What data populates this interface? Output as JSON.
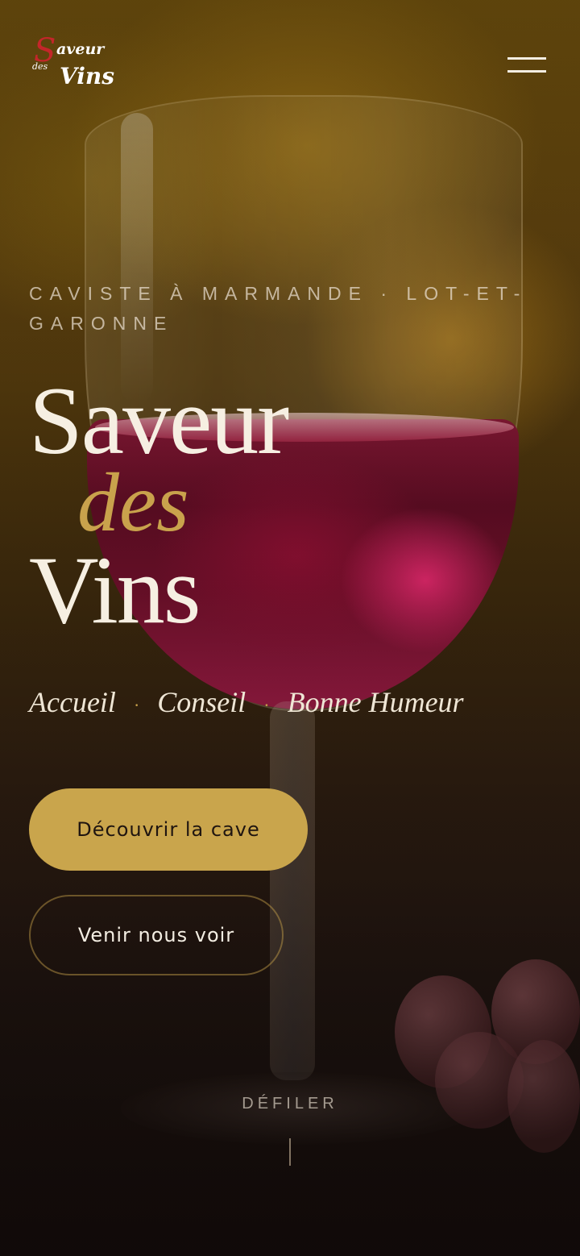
{
  "header": {
    "logo": {
      "initial": "S",
      "word1": "aveur",
      "word2": "des",
      "word3": "Vins"
    },
    "menu_icon": "hamburger-menu-icon"
  },
  "hero": {
    "eyebrow": "CAVISTE À MARMANDE · LOT-ET-GARONNE",
    "title": {
      "line1": "Saveur",
      "line2": "des",
      "line3": "Vins"
    },
    "tagline": {
      "item1": "Accueil",
      "item2": "Conseil",
      "item3": "Bonne Humeur",
      "separator": "·"
    },
    "primary_button": "Découvrir la cave",
    "secondary_button": "Venir nous voir",
    "scroll_label": "DÉFILER"
  },
  "colors": {
    "accent_gold": "#c9a54c",
    "title_cream": "#f6efe2",
    "logo_red": "#c4262a"
  }
}
